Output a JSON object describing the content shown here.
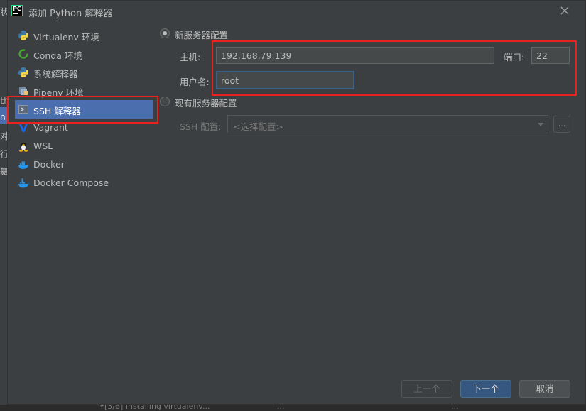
{
  "background_app": {
    "left_fragments": [
      "状",
      "比",
      "n",
      "对",
      "行",
      "舞"
    ],
    "bottom_fragments": [
      "¥[3/6] Installing virtualenv...",
      "...",
      "..."
    ]
  },
  "dialog": {
    "title": "添加 Python 解释器",
    "app_icon_text": "PC"
  },
  "sidebar": {
    "items": [
      {
        "label": "Virtualenv 环境",
        "icon": "python-icon"
      },
      {
        "label": "Conda 环境",
        "icon": "conda-icon"
      },
      {
        "label": "系统解释器",
        "icon": "python-icon"
      },
      {
        "label": "Pipenv 环境",
        "icon": "pipenv-icon"
      },
      {
        "label": "SSH 解释器",
        "icon": "terminal-icon",
        "selected": true
      },
      {
        "label": "Vagrant",
        "icon": "vagrant-icon"
      },
      {
        "label": "WSL",
        "icon": "linux-icon"
      },
      {
        "label": "Docker",
        "icon": "docker-icon"
      },
      {
        "label": "Docker Compose",
        "icon": "docker-compose-icon"
      }
    ]
  },
  "new_server": {
    "radio_label": "新服务器配置",
    "host_label": "主机:",
    "host_value": "192.168.79.139",
    "port_label": "端口:",
    "port_value": "22",
    "username_label": "用户名:",
    "username_value": "root"
  },
  "existing_server": {
    "radio_label": "现有服务器配置",
    "ssh_config_label": "SSH 配置:",
    "ssh_config_value": "<选择配置>",
    "browse_label": "..."
  },
  "buttons": {
    "previous": "上一个",
    "next": "下一个",
    "cancel": "取消"
  },
  "colors": {
    "selected_bg": "#4b6eaf",
    "highlight_red": "#e8231f",
    "primary_button": "#365880"
  }
}
